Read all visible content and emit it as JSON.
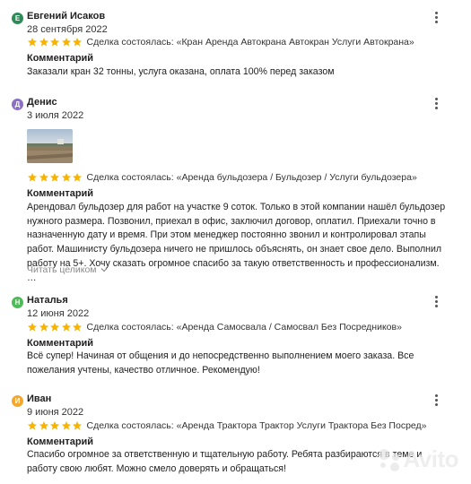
{
  "colors": {
    "star": "#f7b300",
    "avatar_e": "#2e8b57",
    "avatar_d": "#8a6fc4",
    "avatar_n": "#50b95a",
    "avatar_i": "#f2a72f"
  },
  "icons": {
    "menu": "three-dots-vertical-icon",
    "star": "star-icon",
    "expand": "chevron-down-icon"
  },
  "rating_max": 5,
  "reviews": [
    {
      "initial": "Е",
      "name": "Евгений Исаков",
      "date": "28 сентября 2022",
      "rating": 5,
      "deal": "Сделка состоялась: «Кран Аренда Автокрана Автокран Услуги Автокрана»",
      "comment_title": "Комментарий",
      "comment": "Заказали кран 32 тонны, услуга оказана, оплата 100% перед заказом"
    },
    {
      "initial": "Д",
      "name": "Денис",
      "date": "3 июля 2022",
      "rating": 5,
      "deal": "Сделка состоялась: «Аренда бульдозера / Бульдозер / Услуги бульдозера»",
      "comment_title": "Комментарий",
      "comment": "Арендовал бульдозер для работ на участке 9 соток. Только в этой компании нашёл бульдозер нужного размера. Позвонил, приехал в офис, заключил договор, оплатил. Приехали точно в назначенную дату и время. При этом менеджер постоянно звонил и контролировал этапы работ. Машинисту бульдозера ничего не пришлось объяснять, он знает свое дело. Выполнил работу на 5+. Хочу сказать огромное спасибо за такую ответственность и профессионализм. …",
      "read_more": "Читать целиком"
    },
    {
      "initial": "Н",
      "name": "Наталья",
      "date": "12 июня 2022",
      "rating": 5,
      "deal": "Сделка состоялась: «Аренда Самосвала / Самосвал Без Посредников»",
      "comment_title": "Комментарий",
      "comment": "Всё супер! Начиная от общения и до непосредственно выполнением моего заказа. Все пожелания учтены, качество отличное. Рекомендую!"
    },
    {
      "initial": "И",
      "name": "Иван",
      "date": "9 июня 2022",
      "rating": 5,
      "deal": "Сделка состоялась: «Аренда Трактора Трактор Услуги Трактора Без Посред»",
      "comment_title": "Комментарий",
      "comment": "Спасибо огромное за ответственную и тщательную работу. Ребята разбираются в теме и работу свою любят. Можно смело доверять и обращаться!"
    }
  ],
  "watermark": "Avito"
}
